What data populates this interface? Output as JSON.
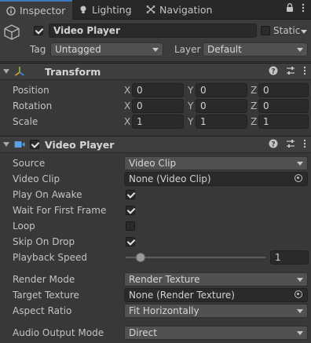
{
  "tabs": [
    {
      "label": "Inspector",
      "icon": "info-icon"
    },
    {
      "label": "Lighting",
      "icon": "lightbulb-icon"
    },
    {
      "label": "Navigation",
      "icon": "navigation-icon"
    }
  ],
  "tab_actions": {
    "lock": "lock-icon",
    "menu": "kebab-menu-icon"
  },
  "gameobject": {
    "name": "Video Player",
    "active": true,
    "static_label": "Static",
    "tag_label": "Tag",
    "tag_value": "Untagged",
    "layer_label": "Layer",
    "layer_value": "Default"
  },
  "transform": {
    "title": "Transform",
    "rows": [
      {
        "label": "Position",
        "x": "0",
        "y": "0",
        "z": "0"
      },
      {
        "label": "Rotation",
        "x": "0",
        "y": "0",
        "z": "0"
      },
      {
        "label": "Scale",
        "x": "1",
        "y": "1",
        "z": "1"
      }
    ],
    "axis": {
      "x": "X",
      "y": "Y",
      "z": "Z"
    }
  },
  "video_player": {
    "title": "Video Player",
    "enabled": true,
    "source_label": "Source",
    "source_value": "Video Clip",
    "video_clip_label": "Video Clip",
    "video_clip_value": "None (Video Clip)",
    "play_on_awake_label": "Play On Awake",
    "play_on_awake": true,
    "wait_first_frame_label": "Wait For First Frame",
    "wait_first_frame": true,
    "loop_label": "Loop",
    "loop": false,
    "skip_on_drop_label": "Skip On Drop",
    "skip_on_drop": true,
    "playback_speed_label": "Playback Speed",
    "playback_speed_value": "1",
    "playback_speed_fraction": 0.1,
    "render_mode_label": "Render Mode",
    "render_mode_value": "Render Texture",
    "target_texture_label": "Target Texture",
    "target_texture_value": "None (Render Texture)",
    "aspect_ratio_label": "Aspect Ratio",
    "aspect_ratio_value": "Fit Horizontally",
    "audio_output_label": "Audio Output Mode",
    "audio_output_value": "Direct"
  },
  "colors": {
    "accent": "#3a79bb",
    "background": "#383838",
    "field": "#2a2a2a"
  }
}
